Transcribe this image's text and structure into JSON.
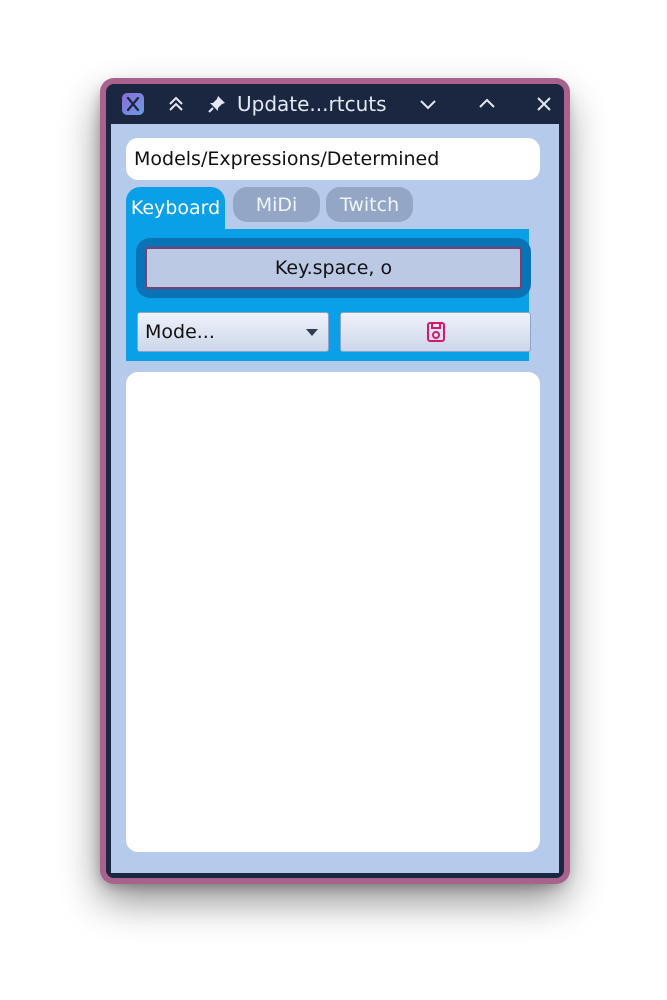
{
  "window": {
    "title": "Update...rtcuts",
    "icons": {
      "app": "app-x-icon",
      "keep_above": "double-chevron-up-icon",
      "pin": "pin-icon",
      "minimize": "chevron-down-icon",
      "maximize": "chevron-up-icon",
      "close": "close-icon"
    }
  },
  "path_field": {
    "value": "Models/Expressions/Determined"
  },
  "tabs": [
    {
      "label": "Keyboard",
      "active": true
    },
    {
      "label": "MiDi",
      "active": false
    },
    {
      "label": "Twitch",
      "active": false
    }
  ],
  "keyboard_panel": {
    "shortcut_label": "Key.space, o",
    "mode_select": {
      "selected": "Mode..."
    },
    "save_icon": "save-disk-icon"
  },
  "colors": {
    "frame": "#a8628c",
    "titlebar": "#1b2740",
    "client_bg": "#b6caeb",
    "accent": "#0aa0e8",
    "save_icon": "#d11a6e"
  }
}
